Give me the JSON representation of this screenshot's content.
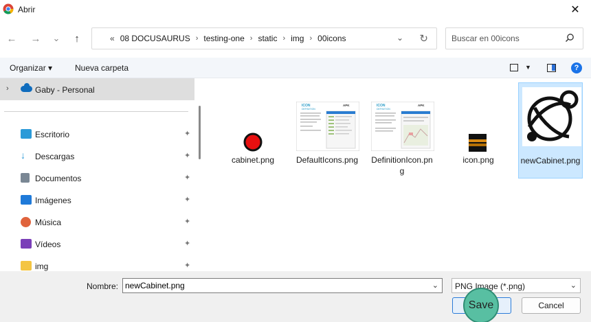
{
  "window": {
    "title": "Abrir",
    "close_glyph": "✕"
  },
  "nav": {
    "back_glyph": "←",
    "forward_glyph": "→",
    "history_glyph": "⌄",
    "up_glyph": "↑",
    "crumbs_prefix": "«",
    "breadcrumbs": [
      "08 DOCUSAURUS",
      "testing-one",
      "static",
      "img",
      "00icons"
    ],
    "search_placeholder": "Buscar en 00icons"
  },
  "toolbar": {
    "organize": "Organizar ▾",
    "new_folder": "Nueva carpeta"
  },
  "sidebar": {
    "account": "Gaby - Personal",
    "items": [
      {
        "label": "Escritorio",
        "icon": "desktop-icon",
        "color": "#2b9ad8"
      },
      {
        "label": "Descargas",
        "icon": "download-icon",
        "color": "#2b9ad8"
      },
      {
        "label": "Documentos",
        "icon": "document-icon",
        "color": "#7a8794"
      },
      {
        "label": "Imágenes",
        "icon": "pictures-icon",
        "color": "#1f7ad9"
      },
      {
        "label": "Música",
        "icon": "music-icon",
        "color": "#e0633c"
      },
      {
        "label": "Vídeos",
        "icon": "video-icon",
        "color": "#7a3fb8"
      },
      {
        "label": "img",
        "icon": "folder-icon",
        "color": "#f4c542"
      }
    ],
    "pin_glyph": "📌"
  },
  "files": [
    {
      "name": "cabinet.png",
      "selected": false
    },
    {
      "name": "DefaultIcons.png",
      "selected": false
    },
    {
      "name": "DefinitionIcon.png",
      "selected": false
    },
    {
      "name": "icon.png",
      "selected": false
    },
    {
      "name": "newCabinet.png",
      "selected": true
    }
  ],
  "thumb_text": {
    "icon_heading": "ICON",
    "definition_heading": "DEFINITION",
    "brand": "APK"
  },
  "bottom": {
    "name_label": "Nombre:",
    "name_value": "newCabinet.png",
    "file_type": "PNG Image (*.png)",
    "save": "Save",
    "cancel": "Cancel"
  },
  "colors": {
    "accent": "#1a73e8",
    "selection": "#cce8ff",
    "highlight": "#58bfa2"
  }
}
